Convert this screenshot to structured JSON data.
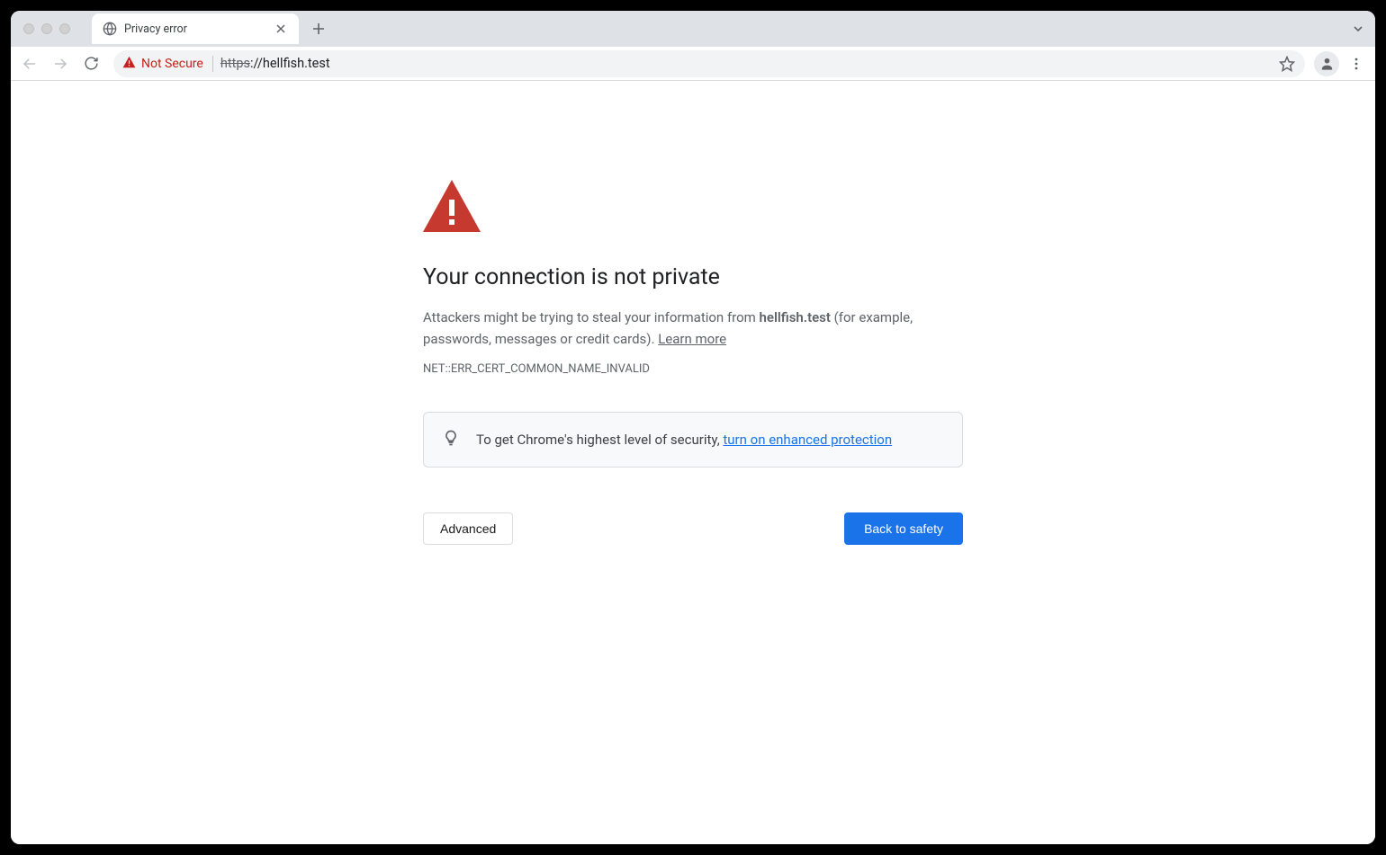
{
  "tab": {
    "title": "Privacy error"
  },
  "omnibox": {
    "security_label": "Not Secure",
    "url_scheme": "https",
    "url_rest": "://hellfish.test"
  },
  "interstitial": {
    "headline": "Your connection is not private",
    "body_prefix": "Attackers might be trying to steal your information from ",
    "body_domain": "hellfish.test",
    "body_suffix": " (for example, passwords, messages or credit cards). ",
    "learn_more": "Learn more",
    "error_code": "NET::ERR_CERT_COMMON_NAME_INVALID",
    "tip_text": "To get Chrome's highest level of security, ",
    "tip_link": "turn on enhanced protection",
    "advanced_label": "Advanced",
    "back_label": "Back to safety"
  }
}
